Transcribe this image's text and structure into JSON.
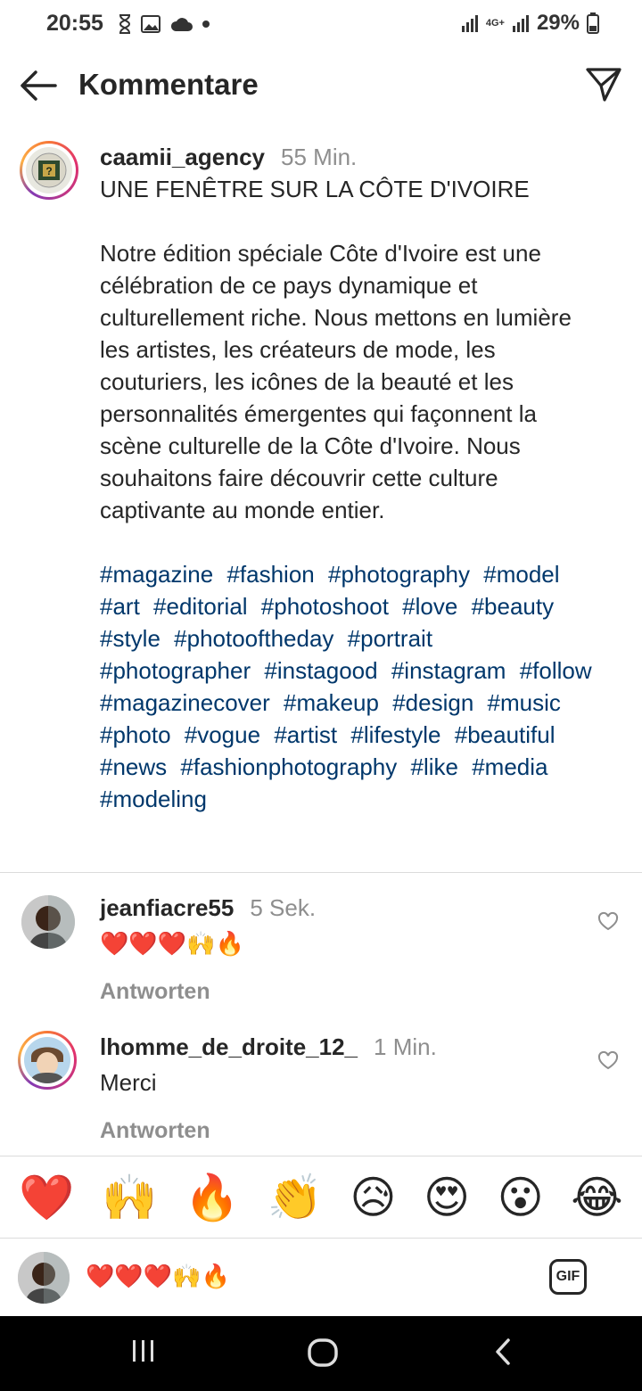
{
  "status": {
    "time": "20:55",
    "battery": "29%",
    "network": "4G+",
    "icons": [
      "hourglass-icon",
      "image-icon",
      "cloud-icon",
      "dot-icon",
      "signal-icon",
      "battery-icon"
    ]
  },
  "header": {
    "title": "Kommentare",
    "back_icon": "back-arrow-icon",
    "send_icon": "send-icon"
  },
  "caption": {
    "username": "caamii_agency",
    "time": "55 Min.",
    "text": "UNE FENÊTRE SUR LA CÔTE D'IVOIRE\n\nNotre édition spéciale Côte d'Ivoire est une célébration de ce pays dynamique et culturellement riche. Nous mettons en lumière les artistes, les créateurs de mode, les couturiers, les icônes de la beauté et les personnalités émergentes qui façonnent la scène culturelle de la Côte d'Ivoire. Nous souhaitons faire découvrir cette culture captivante au monde entier.",
    "hashtags": [
      "#magazine",
      "#fashion",
      "#photography",
      "#model",
      "#art",
      "#editorial",
      "#photoshoot",
      "#love",
      "#beauty",
      "#style",
      "#photooftheday",
      "#portrait",
      "#photographer",
      "#instagood",
      "#instagram",
      "#follow",
      "#magazinecover",
      "#makeup",
      "#design",
      "#music",
      "#photo",
      "#vogue",
      "#artist",
      "#lifestyle",
      "#beautiful",
      "#news",
      "#fashionphotography",
      "#like",
      "#media",
      "#modeling"
    ]
  },
  "comments": [
    {
      "username": "jeanfiacre55",
      "time": "5 Sek.",
      "text": "❤️❤️❤️🙌🔥",
      "reply_label": "Antworten"
    },
    {
      "username": "lhomme_de_droite_12_",
      "time": "1 Min.",
      "text": "Merci",
      "reply_label": "Antworten"
    }
  ],
  "reactions": [
    "❤️",
    "🙌",
    "🔥",
    "👏",
    "😥",
    "😍",
    "😮",
    "😂"
  ],
  "input": {
    "value": "❤️❤️❤️🙌🔥",
    "gif_label": "GIF"
  },
  "colors": {
    "hashtag": "#00376b",
    "muted": "#8e8e8e",
    "text": "#262626"
  }
}
